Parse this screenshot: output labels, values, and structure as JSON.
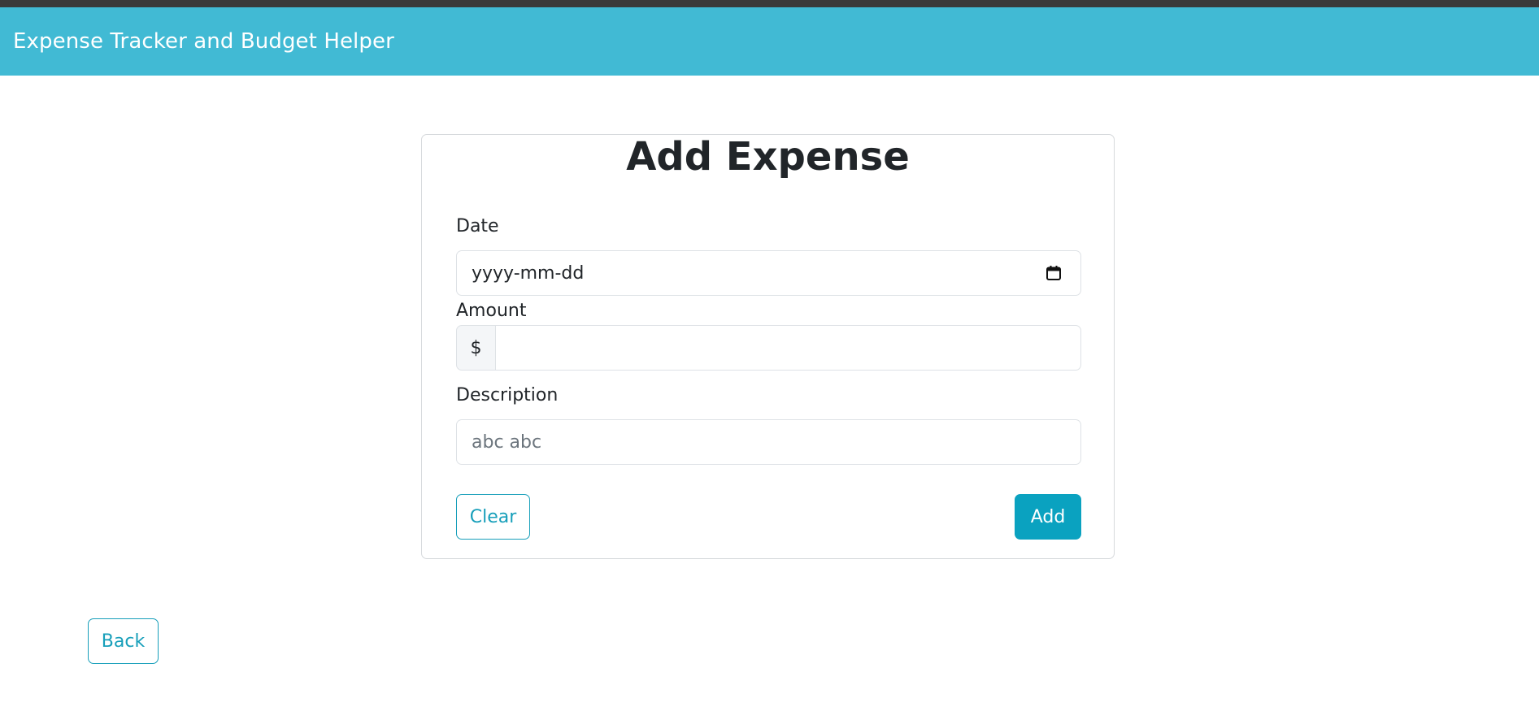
{
  "navbar": {
    "brand": "Expense Tracker and Budget Helper",
    "color": "#41bad4"
  },
  "card": {
    "title": "Add Expense"
  },
  "form": {
    "date_label": "Date",
    "date_placeholder": "yyyy-mm-dd",
    "amount_label": "Amount",
    "amount_prefix": "$",
    "amount_value": "",
    "description_label": "Description",
    "description_placeholder": "abc abc"
  },
  "actions": {
    "clear_label": "Clear",
    "add_label": "Add",
    "back_label": "Back"
  },
  "colors": {
    "accent": "#0aa2c0",
    "outline": "#179fba"
  },
  "icons": {
    "date_picker": "calendar-icon"
  }
}
